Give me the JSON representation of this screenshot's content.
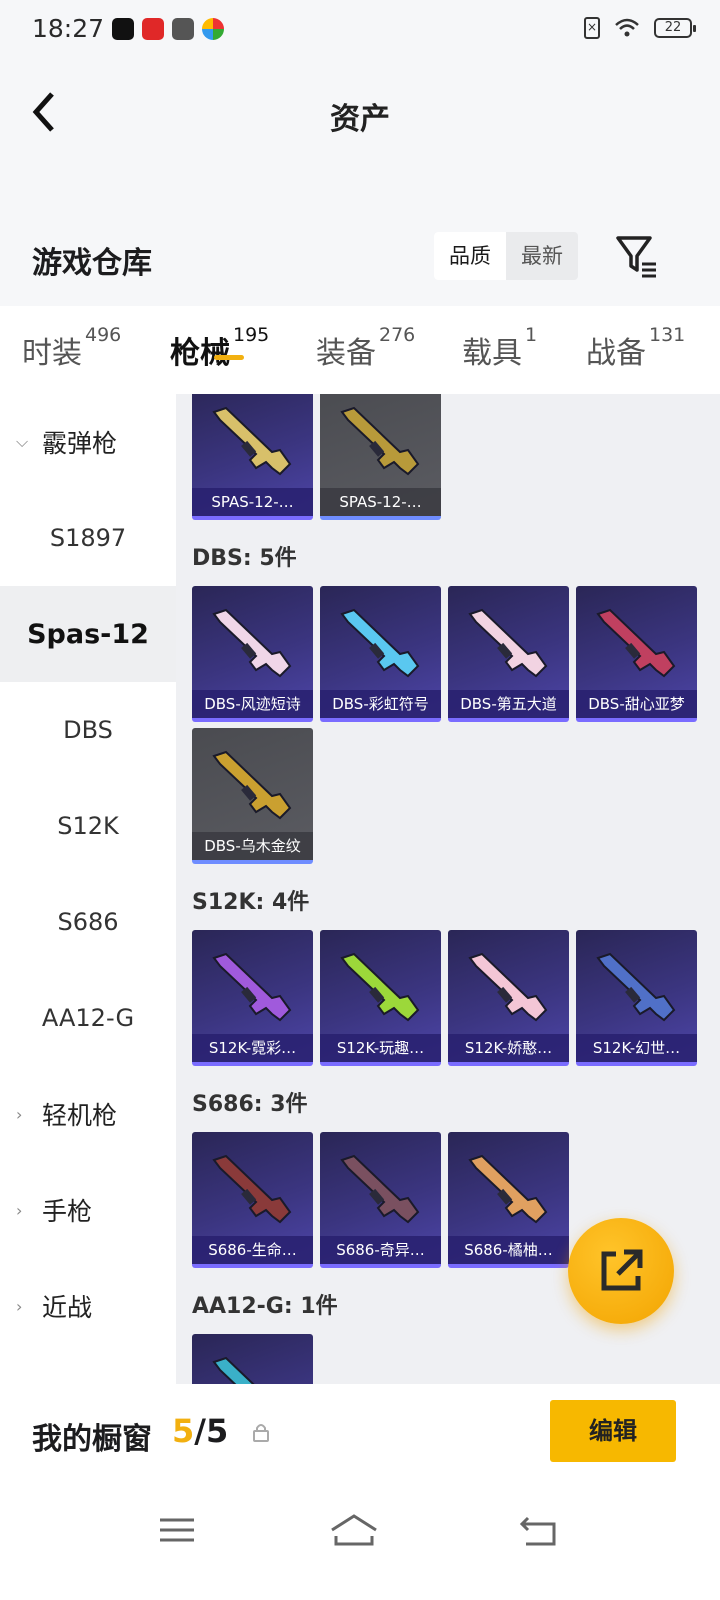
{
  "status": {
    "time": "18:27",
    "battery": "22"
  },
  "header": {
    "title": "资产"
  },
  "warehouse": {
    "title": "游戏仓库",
    "sort_options": [
      "品质",
      "最新"
    ],
    "sort_active": "品质"
  },
  "tabs": [
    {
      "label": "时装",
      "count": "496"
    },
    {
      "label": "枪械",
      "count": "195",
      "active": true
    },
    {
      "label": "装备",
      "count": "276"
    },
    {
      "label": "载具",
      "count": "1"
    },
    {
      "label": "战备",
      "count": "131"
    }
  ],
  "sidebar": {
    "category": "霰弹枪",
    "items": [
      "S1897",
      "Spas-12",
      "DBS",
      "S12K",
      "S686",
      "AA12-G"
    ],
    "active": "Spas-12",
    "other_categories": [
      "轻机枪",
      "手枪",
      "近战"
    ]
  },
  "sections": {
    "spas": {
      "items": [
        {
          "label": "SPAS-12-…",
          "style": "purple",
          "gun": "#d8c06a"
        },
        {
          "label": "SPAS-12-…",
          "style": "gray",
          "gun": "#b89a3a"
        }
      ]
    },
    "dbs": {
      "title": "DBS: 5件",
      "items": [
        {
          "label": "DBS-风迹短诗",
          "style": "purple",
          "gun": "#f0d6e8"
        },
        {
          "label": "DBS-彩虹符号",
          "style": "purple",
          "gun": "#5ac8f0"
        },
        {
          "label": "DBS-第五大道",
          "style": "purple",
          "gun": "#f2d3e2"
        },
        {
          "label": "DBS-甜心亚梦",
          "style": "purple",
          "gun": "#c04060"
        },
        {
          "label": "DBS-乌木金纹",
          "style": "gray",
          "gun": "#caa030"
        }
      ]
    },
    "s12k": {
      "title": "S12K: 4件",
      "items": [
        {
          "label": "S12K-霓彩…",
          "style": "purple",
          "gun": "#a05adc"
        },
        {
          "label": "S12K-玩趣…",
          "style": "purple",
          "gun": "#9cd83a"
        },
        {
          "label": "S12K-娇憨…",
          "style": "purple",
          "gun": "#f4c6d6"
        },
        {
          "label": "S12K-幻世…",
          "style": "purple",
          "gun": "#5070c8"
        }
      ]
    },
    "s686": {
      "title": "S686: 3件",
      "items": [
        {
          "label": "S686-生命…",
          "style": "purple",
          "gun": "#8a3a3a"
        },
        {
          "label": "S686-奇异…",
          "style": "purple",
          "gun": "#7a5060"
        },
        {
          "label": "S686-橘柚…",
          "style": "purple",
          "gun": "#e0a060"
        }
      ]
    },
    "aa12": {
      "title": "AA12-G: 1件",
      "items": [
        {
          "label": "",
          "style": "purple",
          "gun": "#3ab0c8"
        }
      ]
    }
  },
  "bottom": {
    "label": "我的橱窗",
    "count_current": "5",
    "count_sep": "/",
    "count_total": "5",
    "edit_label": "编辑"
  },
  "colors": {
    "accent": "#f2b010",
    "card_purple": "#3b3580",
    "card_gray": "#55565b"
  }
}
